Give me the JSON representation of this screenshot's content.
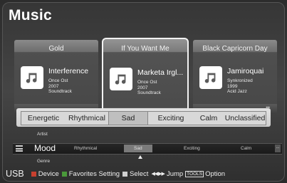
{
  "title": "Music",
  "cards": [
    {
      "category": "Gold",
      "track": "Interference",
      "meta": [
        "Once Ost",
        "2007",
        "Soundtrack"
      ],
      "selected": false
    },
    {
      "category": "If You Want Me",
      "track": "Marketa Irgl...",
      "meta": [
        "Once Ost",
        "2007",
        "Soundtrack"
      ],
      "selected": true
    },
    {
      "category": "Black Capricorn Day",
      "track": "Jamiroquai",
      "meta": [
        "Synkronized",
        "1999",
        "Acid Jazz"
      ],
      "selected": false
    }
  ],
  "mood_options": [
    "Energetic",
    "Rhythmical",
    "Sad",
    "Exciting",
    "Calm",
    "Unclassified"
  ],
  "mood_selected": "Sad",
  "category_above": "Artist",
  "category_current": "Mood",
  "category_below": "Genre",
  "strip_items": [
    "Rhythmical",
    "Sad",
    "Exciting",
    "Calm"
  ],
  "strip_more": "...",
  "bottom_bar": {
    "source": "USB",
    "device": "Device",
    "favorites": "Favorites Setting",
    "select": "Select",
    "jump": "Jump",
    "tools_label": "TOOLS",
    "option": "Option"
  },
  "colors": {
    "red": "#c8402f",
    "green": "#4a9a3a",
    "yellow": "#d8b42a",
    "blue": "#3f63a8"
  }
}
